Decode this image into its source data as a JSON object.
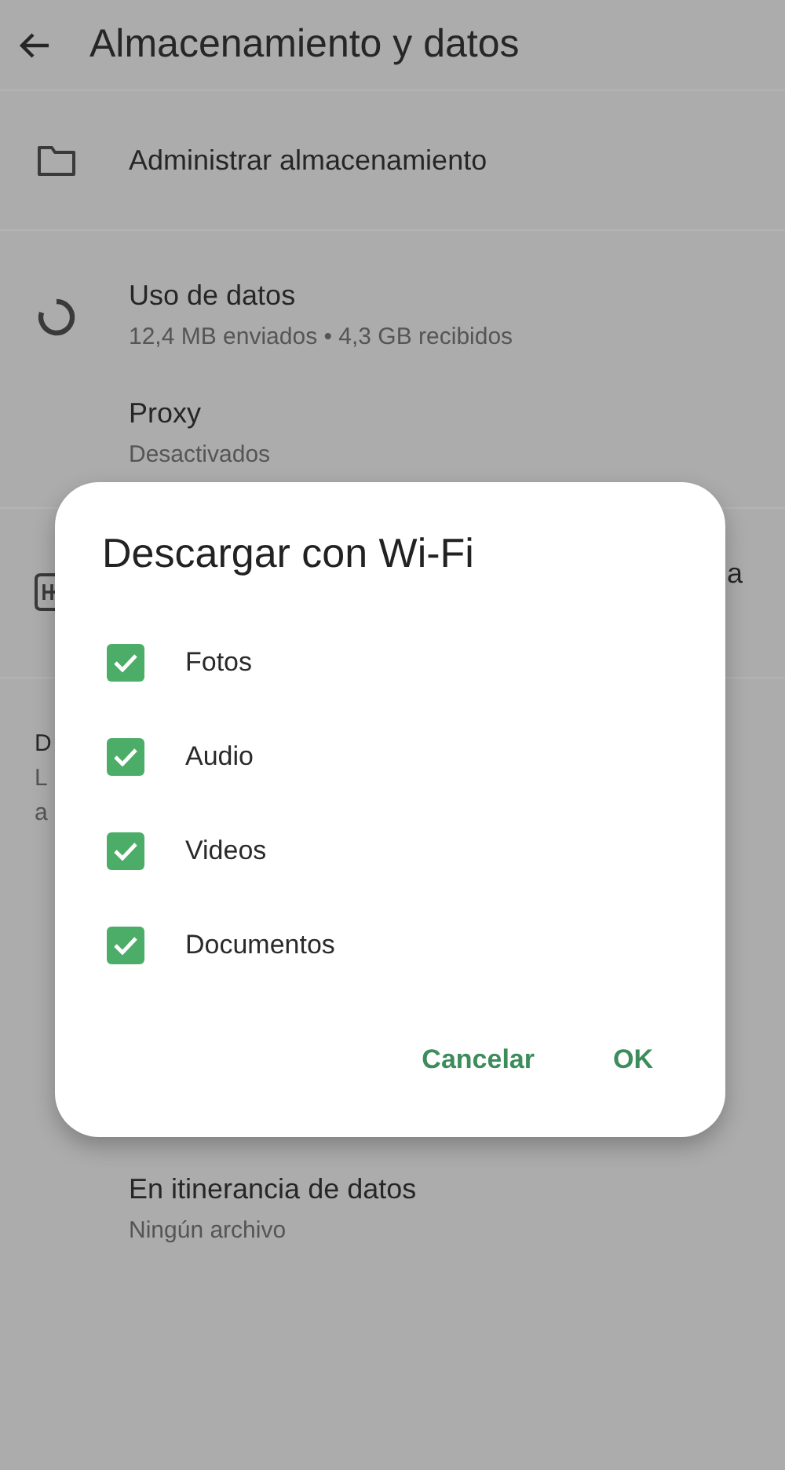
{
  "header": {
    "title": "Almacenamiento y datos"
  },
  "settings": [
    {
      "kind": "folder",
      "title": "Administrar almacenamiento"
    },
    {
      "kind": "donut",
      "title": "Uso de datos",
      "subtitle": "12,4 MB enviados • 4,3 GB recibidos"
    },
    {
      "kind": "plain",
      "title": "Proxy",
      "subtitle": "Desactivados"
    },
    {
      "kind": "badge",
      "tail": "a"
    },
    {
      "kind": "section",
      "heading": "D",
      "lines": [
        "L",
        "a"
      ]
    },
    {
      "kind": "plain",
      "title": "En itinerancia de datos",
      "subtitle": "Ningún archivo"
    }
  ],
  "dialog": {
    "title": "Descargar con Wi-Fi",
    "options": [
      {
        "label": "Fotos",
        "checked": true
      },
      {
        "label": "Audio",
        "checked": true
      },
      {
        "label": "Videos",
        "checked": true
      },
      {
        "label": "Documentos",
        "checked": true
      }
    ],
    "buttons": [
      {
        "label": "Cancelar"
      },
      {
        "label": "OK"
      }
    ]
  }
}
